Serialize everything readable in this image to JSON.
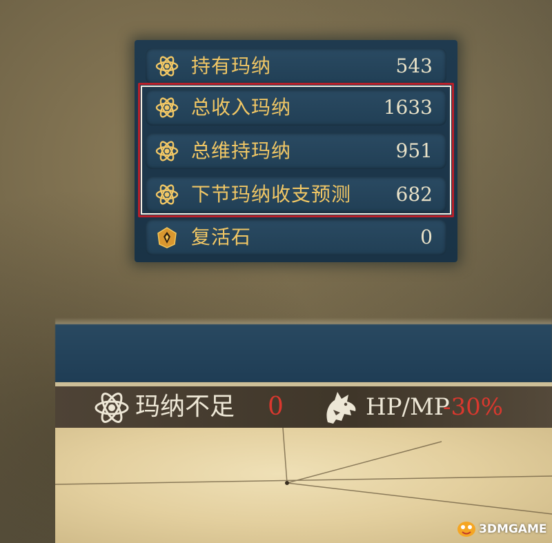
{
  "stats": [
    {
      "icon": "mana-icon",
      "label": "持有玛纳",
      "value": "543"
    },
    {
      "icon": "mana-icon",
      "label": "总收入玛纳",
      "value": "1633"
    },
    {
      "icon": "mana-icon",
      "label": "总维持玛纳",
      "value": "951"
    },
    {
      "icon": "mana-icon",
      "label": "下节玛纳收支预测",
      "value": "682"
    },
    {
      "icon": "revive-stone-icon",
      "label": "复活石",
      "value": "0"
    }
  ],
  "banner": {
    "mana_short_label": "玛纳不足",
    "mana_short_value": "0",
    "hpmp_label": "HP/MP",
    "hpmp_value": "-30%"
  },
  "watermark": {
    "text": "3DMGAME"
  },
  "colors": {
    "label_gold": "#f1c765",
    "value_cream": "#e9e2c8",
    "penalty_red": "#d9382e",
    "highlight_red": "#b8202a",
    "panel_blue": "#1f3a4f"
  }
}
